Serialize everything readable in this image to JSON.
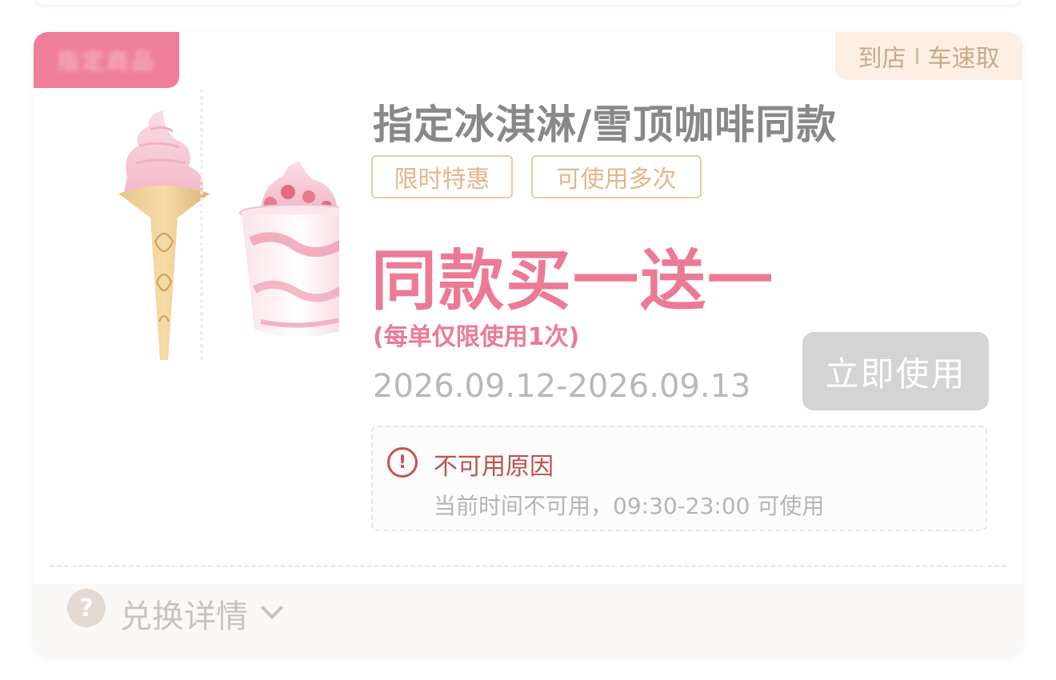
{
  "coupon": {
    "corner_badge": "指定商品",
    "channel": {
      "left": "到店",
      "right": "车速取"
    },
    "title": "指定冰淇淋/雪顶咖啡同款",
    "tags": [
      "限时特惠",
      "可使用多次"
    ],
    "headline": "同款买一送一",
    "limit_note": "(每单仅限使用1次)",
    "validity": "2026.09.12-2026.09.13",
    "use_button": "立即使用",
    "unavailable": {
      "icon_char": "!",
      "title": "不可用原因",
      "detail": "当前时间不可用，09:30-23:00 可使用"
    },
    "footer": {
      "help_icon_char": "?",
      "details_label": "兑换详情"
    }
  },
  "icons": {
    "reason": "alert-circle-icon",
    "help": "question-circle-icon",
    "expand": "chevron-down-icon"
  },
  "colors": {
    "accent_pink": "#ec7a95",
    "button_disabled": "#d4d4d4",
    "warning_red": "#c0504d",
    "tag_orange": "#e5b68b"
  }
}
